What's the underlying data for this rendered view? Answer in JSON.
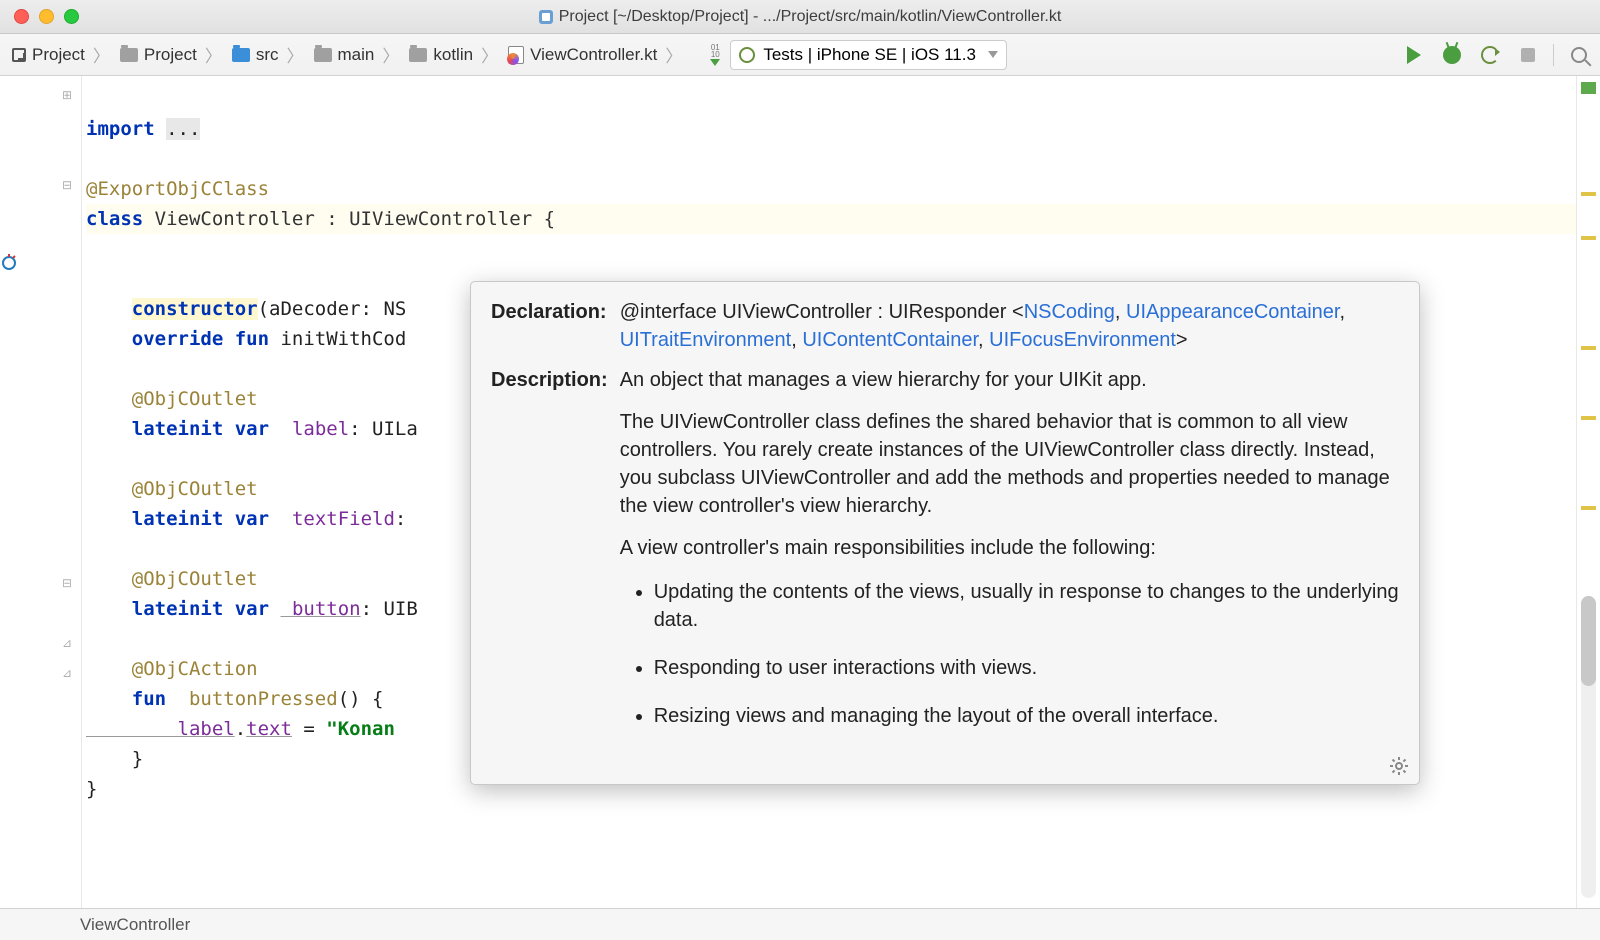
{
  "window": {
    "title": "Project [~/Desktop/Project] - .../Project/src/main/kotlin/ViewController.kt"
  },
  "breadcrumbs": {
    "root": "Project",
    "b1": "Project",
    "b2": "src",
    "b3": "main",
    "b4": "kotlin",
    "b5": "ViewController.kt"
  },
  "run_config": {
    "label": "Tests | iPhone SE | iOS 11.3"
  },
  "code": {
    "l00": "import ",
    "l00b": "...",
    "l02": "@ExportObjCClass",
    "l03a": "class",
    "l03b": " ViewController : UIViewController {",
    "l05a": "constructor",
    "l05b": "(aDecoder: NS",
    "l06a": "    override",
    "l06b": " fun",
    "l06c": " initWithCod",
    "l08": "    @ObjCOutlet",
    "l09a": "    lateinit",
    "l09b": " var",
    "l09c": " label",
    "l09d": ": UILa",
    "l11": "    @ObjCOutlet",
    "l12a": "    lateinit",
    "l12b": " var",
    "l12c": " textField",
    "l12d": ": ",
    "l14": "    @ObjCOutlet",
    "l15a": "    lateinit",
    "l15b": " var",
    "l15c": " button",
    "l15d": ": UIB",
    "l17": "    @ObjCAction",
    "l18a": "    fun",
    "l18b": " buttonPressed",
    "l18c": "() {",
    "l19a": "        label",
    "l19b": ".",
    "l19c": "text",
    "l19d": " = ",
    "l19e": "\"Konan",
    "l20": "    }",
    "l21": "}"
  },
  "doc": {
    "k1": "Declaration:",
    "d1a": "@interface UIViewController : UIResponder <",
    "d1_links": [
      "NSCoding",
      "UIAppearanceContainer",
      "UITraitEnvironment",
      "UIContentContainer",
      "UIFocusEnvironment"
    ],
    "k2": "Description:",
    "d2a": "An object that manages a view hierarchy for your UIKit app.",
    "d2b": "The UIViewController class defines the shared behavior that is common to all view controllers. You rarely create instances of the UIViewController class directly. Instead, you subclass UIViewController and add the methods and properties needed to manage the view controller's view hierarchy.",
    "d2c": "A view controller's main responsibilities include the following:",
    "li1": "Updating the contents of the views, usually in response to changes to the underlying data.",
    "li2": "Responding to user interactions with views.",
    "li3": "Resizing views and managing the layout of the overall interface."
  },
  "status": {
    "text": "ViewController"
  }
}
